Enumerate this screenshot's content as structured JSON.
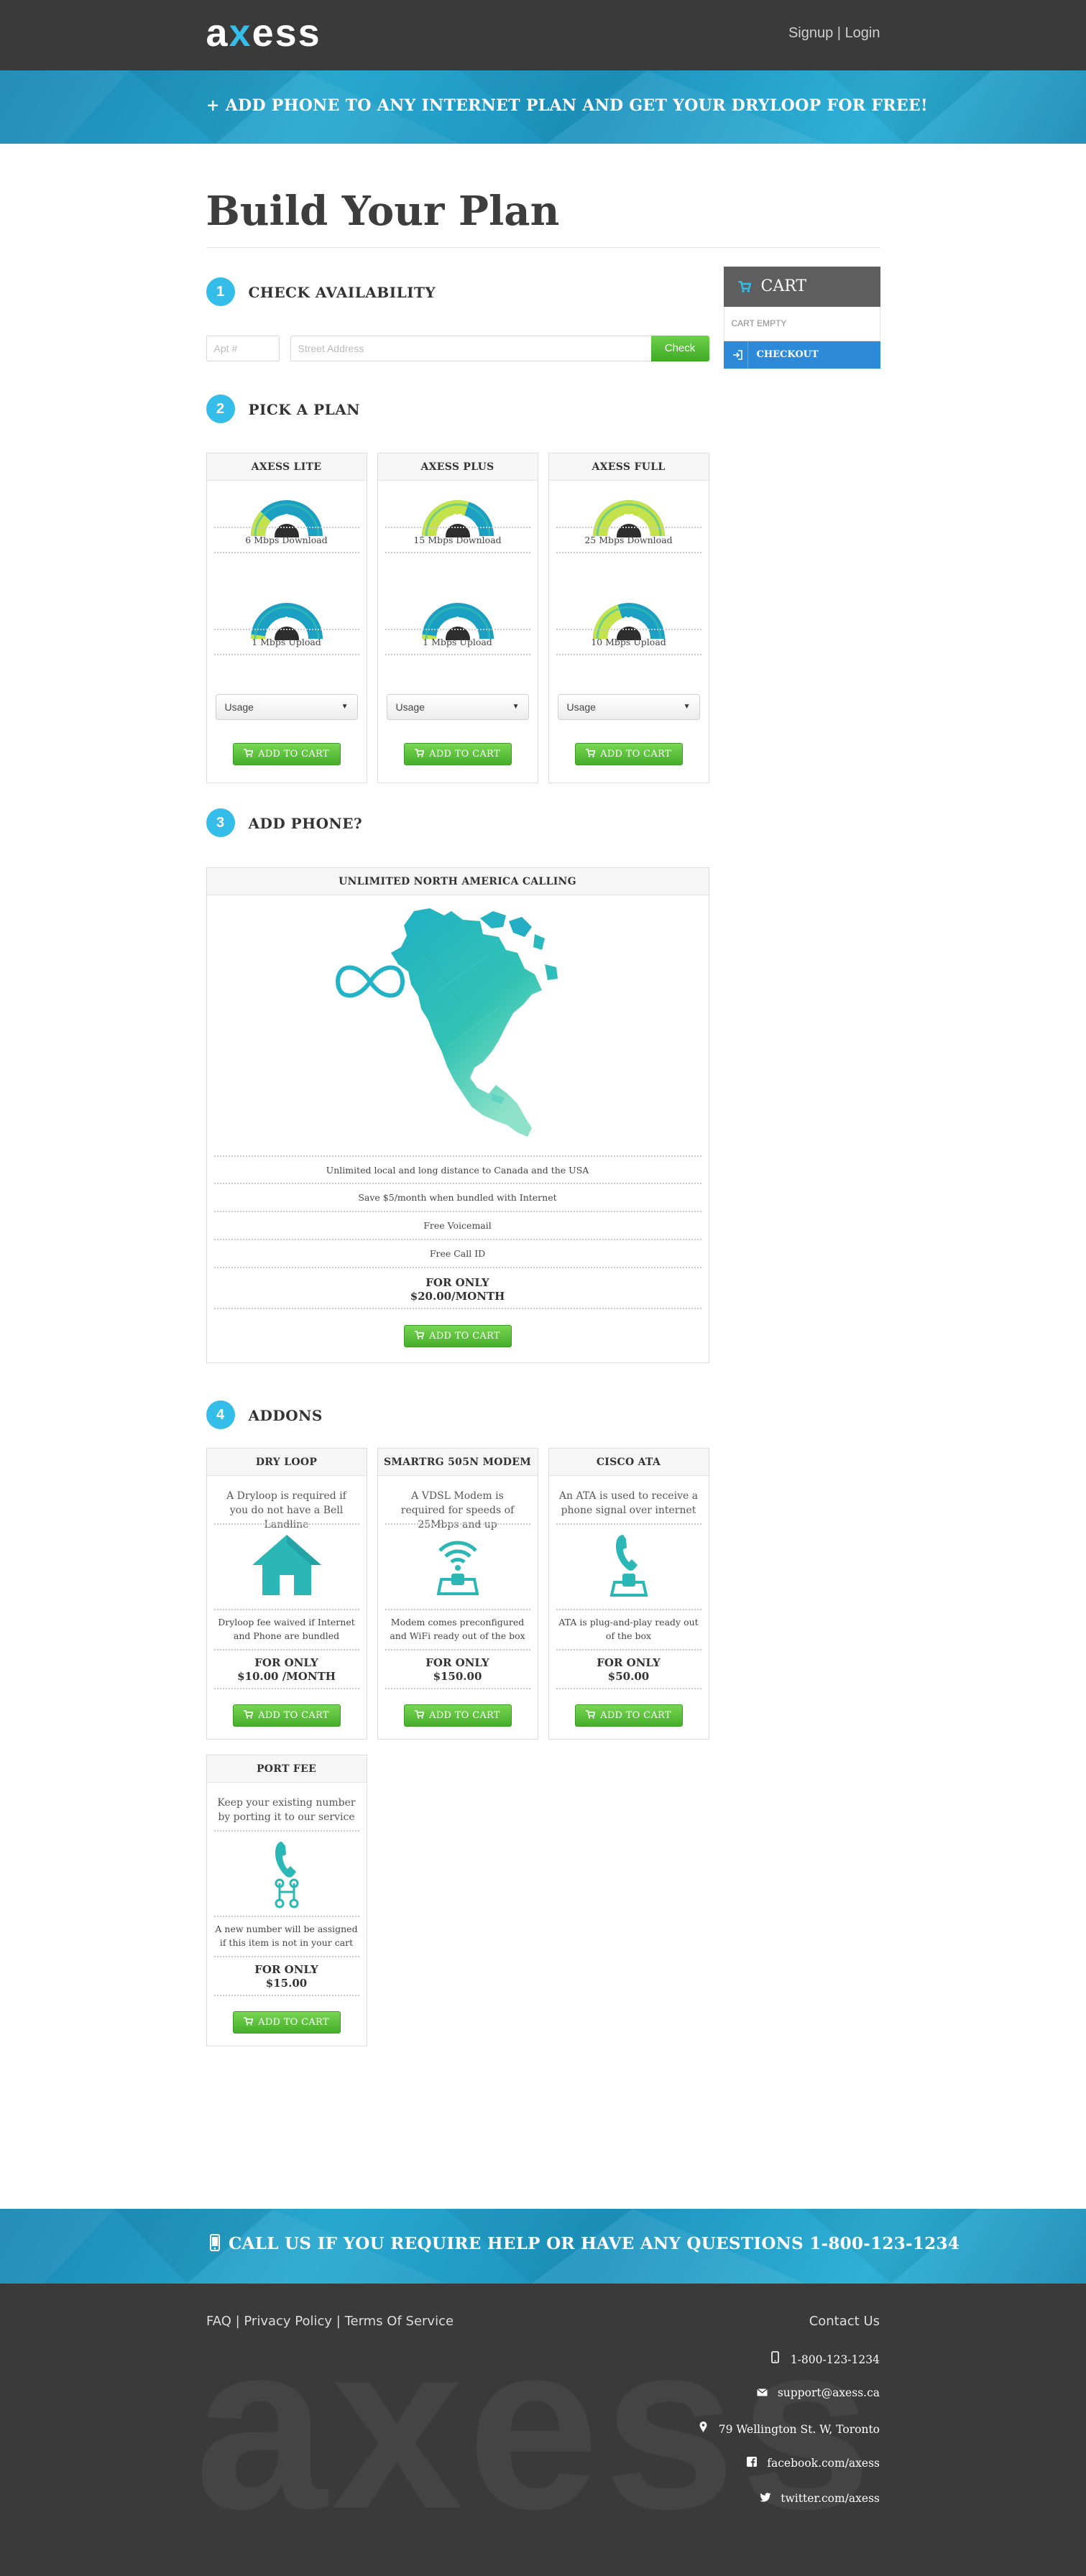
{
  "brand": {
    "logo_left": "a",
    "logo_x": "x",
    "logo_right": "ess"
  },
  "header": {
    "signup": "Signup",
    "separator": " | ",
    "login": "Login"
  },
  "promo": {
    "text": "+ ADD PHONE TO ANY INTERNET PLAN AND GET YOUR DRYLOOP FOR FREE!"
  },
  "page": {
    "title": "Build Your Plan"
  },
  "steps": [
    {
      "num": "1",
      "label": "CHECK AVAILABILITY"
    },
    {
      "num": "2",
      "label": "PICK A PLAN"
    },
    {
      "num": "3",
      "label": "ADD PHONE?"
    },
    {
      "num": "4",
      "label": "ADDONS"
    }
  ],
  "availability": {
    "apt_placeholder": "Apt #",
    "address_placeholder": "Street Address",
    "check_label": "Check"
  },
  "plans": [
    {
      "name": "AXESS LITE",
      "download": "6",
      "download_label": "6 Mbps Download",
      "upload": "1",
      "upload_label": "1 Mbps Upload",
      "usage": "Usage",
      "add": "ADD TO CART"
    },
    {
      "name": "AXESS PLUS",
      "download": "15",
      "download_label": "15 Mbps Download",
      "upload": "1",
      "upload_label": "1 Mbps Upload",
      "usage": "Usage",
      "add": "ADD TO CART"
    },
    {
      "name": "AXESS FULL",
      "download": "25",
      "download_label": "25 Mbps Download",
      "upload": "10",
      "upload_label": "10 Mbps Upload",
      "usage": "Usage",
      "add": "ADD TO CART"
    }
  ],
  "gauge_levels": {
    "max_mbps": 25
  },
  "phone": {
    "title": "UNLIMITED NORTH AMERICA CALLING",
    "features": [
      "Unlimited local and long distance to Canada and the USA",
      "Save $5/month when bundled with Internet",
      "Free Voicemail",
      "Free Call ID"
    ],
    "price_label": "FOR ONLY",
    "price": "$20.00/MONTH",
    "add": "ADD TO CART"
  },
  "addons": [
    {
      "name": "DRY LOOP",
      "desc": "A Dryloop is required if you do not have a Bell Landline",
      "icon": "house-icon",
      "note": "Dryloop fee waived if Internet and Phone are bundled",
      "price_label": "FOR ONLY",
      "price": "$10.00 /MONTH",
      "add": "ADD TO CART"
    },
    {
      "name": "SMARTRG 505N MODEM",
      "desc": "A VDSL Modem is required for speeds of 25Mbps and up",
      "icon": "modem-icon",
      "note": "Modem comes preconfigured and WiFi ready out of the box",
      "price_label": "FOR ONLY",
      "price": "$150.00",
      "add": "ADD TO CART"
    },
    {
      "name": "CISCO ATA",
      "desc": "An ATA is used to receive a phone signal over internet",
      "icon": "ata-icon",
      "note": "ATA is plug-and-play ready out of the box",
      "price_label": "FOR ONLY",
      "price": "$50.00",
      "add": "ADD TO CART"
    },
    {
      "name": "PORT FEE",
      "desc": "Keep your existing number by porting it to our service",
      "icon": "port-icon",
      "note": "A new number will be assigned if this item is not in your cart",
      "price_label": "FOR ONLY",
      "price": "$15.00",
      "add": "ADD TO CART"
    }
  ],
  "cart": {
    "title": "CART",
    "empty": "CART EMPTY",
    "checkout": "CHECKOUT"
  },
  "help": {
    "text": "CALL US IF YOU REQUIRE HELP OR HAVE ANY QUESTIONS 1-800-123-1234"
  },
  "footer": {
    "faq": "FAQ",
    "privacy": "Privacy Policy",
    "terms": "Terms Of Service",
    "sep": " | ",
    "contact_title": "Contact Us",
    "phone": "1-800-123-1234",
    "email": "support@axess.ca",
    "address": "79 Wellington St. W, Toronto",
    "facebook": "facebook.com/axess",
    "twitter": "twitter.com/axess",
    "watermark": "axess"
  },
  "colors": {
    "accent": "#34bde8",
    "header_bg": "#3a3a3a",
    "green": "#4fb830",
    "checkout_blue": "#2c8ad8",
    "teal": "#2ab7b5"
  }
}
